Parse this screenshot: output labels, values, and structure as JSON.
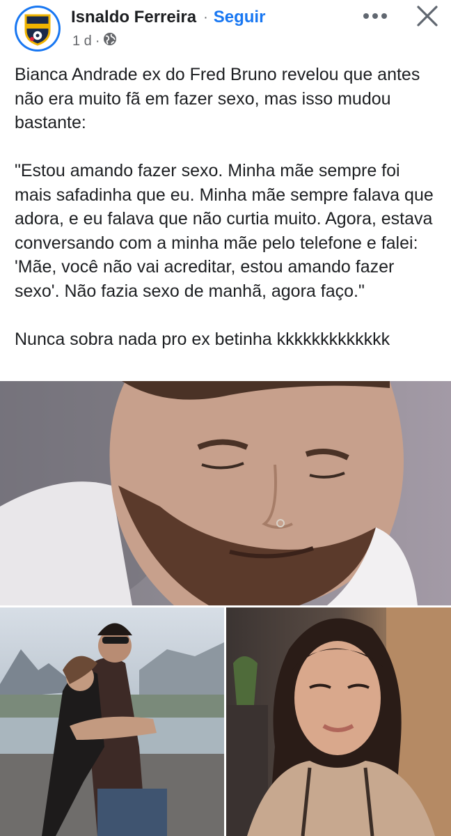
{
  "post": {
    "author": "Isnaldo Ferreira",
    "separator": "·",
    "follow_label": "Seguir",
    "time": "1 d",
    "time_separator": "·",
    "privacy_icon": "globe-icon",
    "more_icon": "more-horizontal-icon",
    "close_icon": "close-icon",
    "avatar_icon": "football-badge-logo",
    "paragraph_1": "Bianca Andrade ex do Fred Bruno revelou que antes não era muito fã em fazer sexo, mas isso mudou bastante:",
    "paragraph_2": "\"Estou amando fazer sexo. Minha mãe sempre foi mais safadinha que eu. Minha mãe sempre falava que adora, e eu falava que não curtia muito. Agora, estava conversando com a minha mãe pelo telefone e falei: 'Mãe, você não vai acreditar, estou amando fazer sexo'. Não fazia sexo de manhã, agora faço.\"",
    "paragraph_3": "Nunca sobra nada pro ex betinha kkkkkkkkkkkkk"
  },
  "colors": {
    "accent": "#1877f2",
    "text": "#1c1e21",
    "secondary_text": "#65676b"
  }
}
